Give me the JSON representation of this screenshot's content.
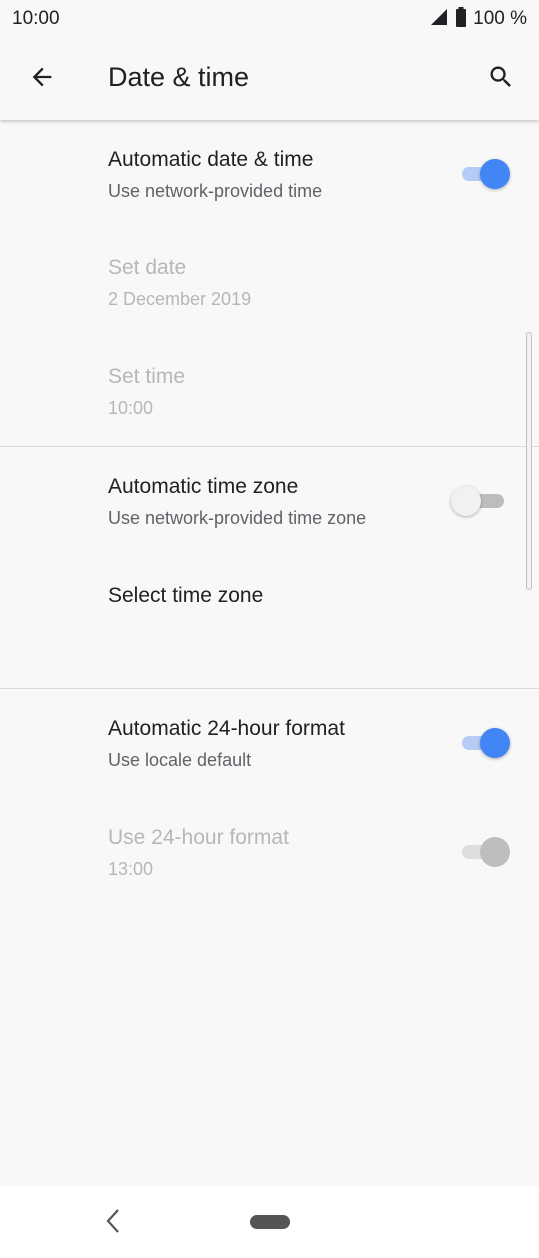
{
  "status_bar": {
    "time": "10:00",
    "battery": "100 %",
    "signal_icon": "signal-icon",
    "battery_icon": "battery-icon"
  },
  "app_bar": {
    "title": "Date & time",
    "back_icon": "back-arrow-icon",
    "search_icon": "search-icon"
  },
  "settings": {
    "auto_date_time": {
      "title": "Automatic date & time",
      "summary": "Use network-provided time",
      "enabled": true
    },
    "set_date": {
      "title": "Set date",
      "summary": "2 December 2019"
    },
    "set_time": {
      "title": "Set time",
      "summary": "10:00"
    },
    "auto_time_zone": {
      "title": "Automatic time zone",
      "summary": "Use network-provided time zone",
      "enabled": false
    },
    "select_time_zone": {
      "title": "Select time zone"
    },
    "auto_24h": {
      "title": "Automatic 24-hour format",
      "summary": "Use locale default",
      "enabled": true
    },
    "use_24h": {
      "title": "Use 24-hour format",
      "summary": "13:00",
      "enabled": true
    }
  },
  "colors": {
    "accent": "#4285f4",
    "accent_track": "#b6ccf6",
    "disabled_text": "#b7b7b7",
    "background": "#f8f8f8"
  },
  "nav_bar": {
    "back_icon": "nav-back-icon",
    "home_icon": "home-pill-icon"
  }
}
